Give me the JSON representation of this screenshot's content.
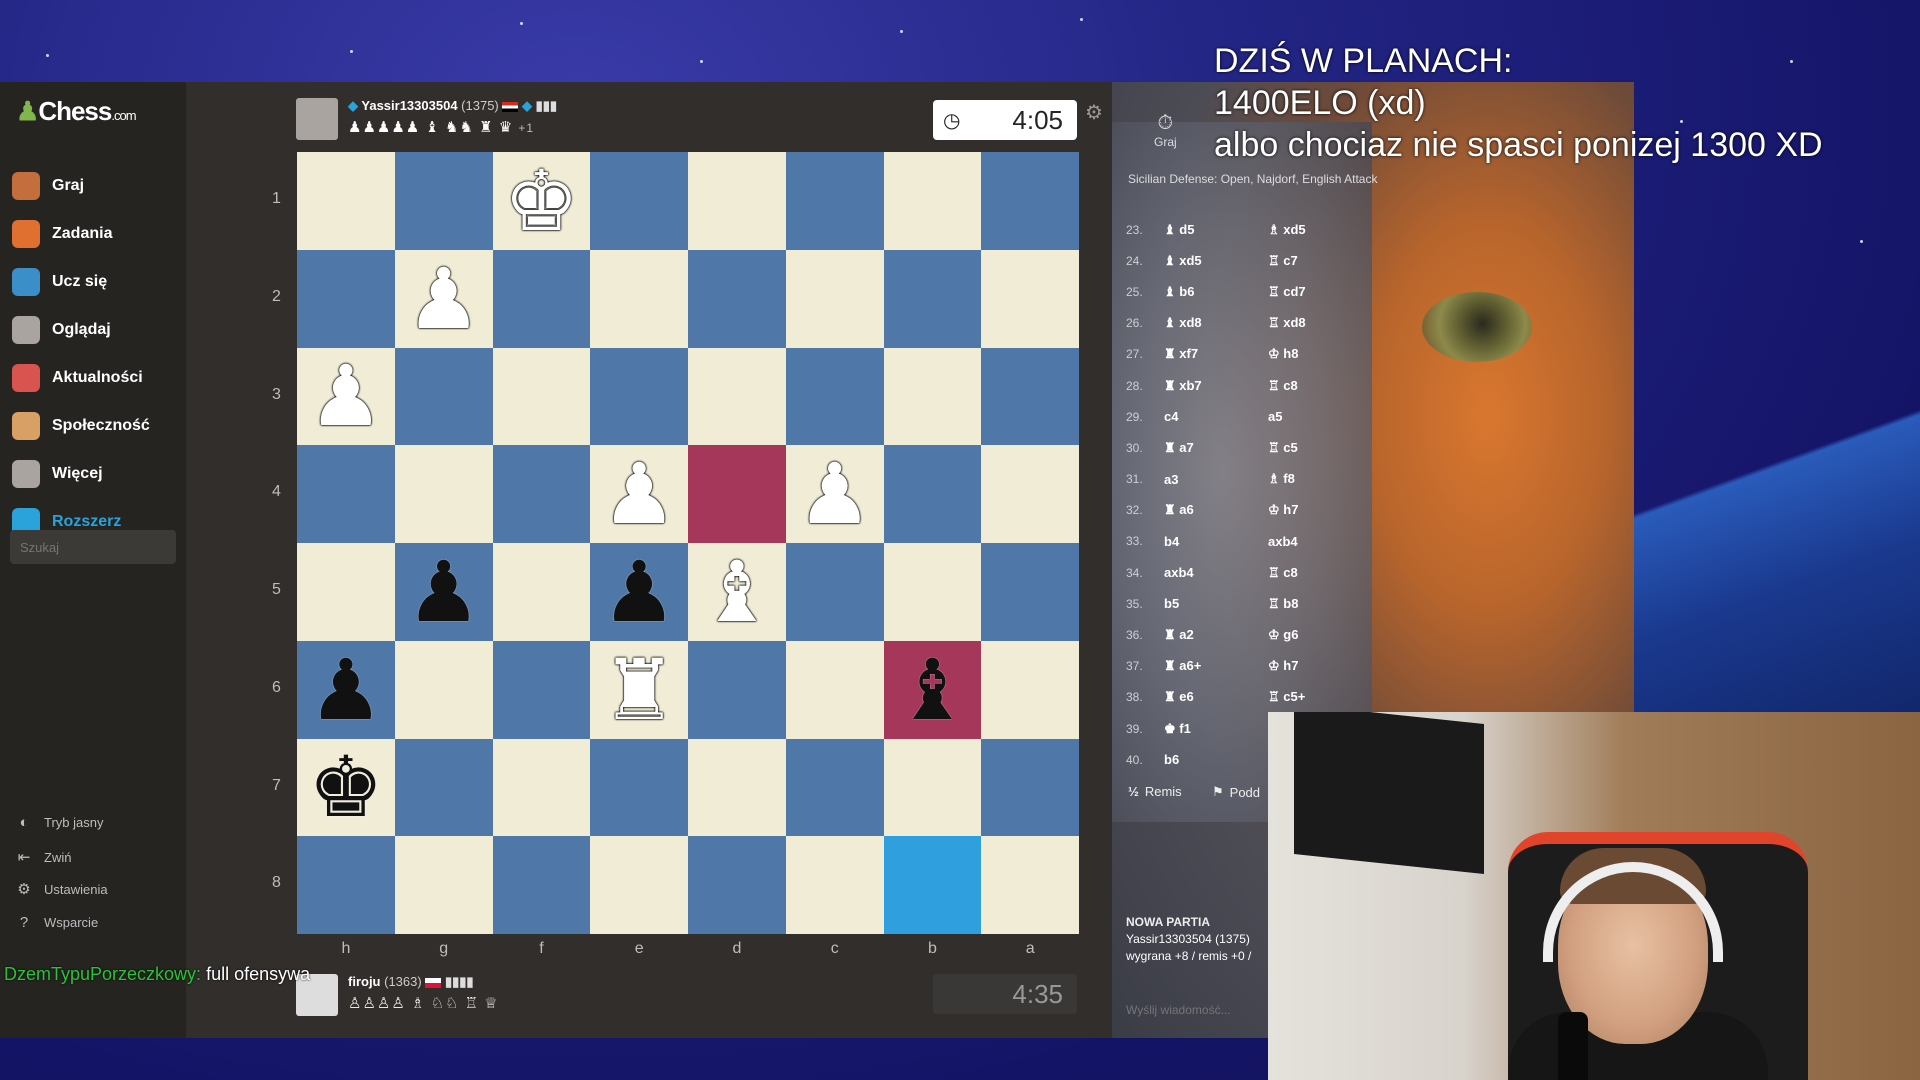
{
  "overlay": {
    "line1": "DZIŚ W PLANACH:",
    "line2": "1400ELO (xd)",
    "line3": "albo chociaz nie spasci ponizej 1300 XD"
  },
  "sidebar": {
    "logo_main": "Chess",
    "logo_suffix": ".com",
    "items": [
      {
        "label": "Graj",
        "icon": "play-icon",
        "color": "#c46d3d"
      },
      {
        "label": "Zadania",
        "icon": "puzzle-icon",
        "color": "#e0702f"
      },
      {
        "label": "Ucz się",
        "icon": "learn-icon",
        "color": "#3b8fc9"
      },
      {
        "label": "Oglądaj",
        "icon": "binoculars-icon",
        "color": "#a9a49f"
      },
      {
        "label": "Aktualności",
        "icon": "news-icon",
        "color": "#d9534f"
      },
      {
        "label": "Społeczność",
        "icon": "community-icon",
        "color": "#d9a066"
      },
      {
        "label": "Więcej",
        "icon": "more-icon",
        "color": "#a9a49f"
      },
      {
        "label": "Rozszerz",
        "icon": "diamond-icon",
        "color": "#29a3d9"
      }
    ],
    "search_placeholder": "Szukaj",
    "footer": [
      {
        "label": "Tryb jasny",
        "icon": "theme-icon"
      },
      {
        "label": "Zwiń",
        "icon": "collapse-icon"
      },
      {
        "label": "Ustawienia",
        "icon": "settings-icon"
      },
      {
        "label": "Wsparcie",
        "icon": "help-icon"
      }
    ]
  },
  "top_player": {
    "name": "Yassir13303504",
    "rating": "(1375)",
    "captured": "♟♟♟♟♟ ♝ ♞♞ ♜ ♛",
    "advantage": "+1",
    "clock": "4:05"
  },
  "bottom_player": {
    "name": "firoju",
    "rating": "(1363)",
    "captured": "♙♙♙♙ ♗ ♘♘ ♖ ♕",
    "clock": "4:35"
  },
  "board": {
    "ranks": [
      "1",
      "2",
      "3",
      "4",
      "5",
      "6",
      "7",
      "8"
    ],
    "files": [
      "h",
      "g",
      "f",
      "e",
      "d",
      "c",
      "b",
      "a"
    ],
    "highlight_from_color": "#a5375a",
    "highlight_to_color": "#2f9fdd",
    "squares": [
      [
        "",
        "",
        "wK",
        "",
        "",
        "",
        "",
        ""
      ],
      [
        "",
        "wP",
        "",
        "",
        "",
        "",
        "",
        ""
      ],
      [
        "wP",
        "",
        "",
        "",
        "",
        "",
        "",
        ""
      ],
      [
        "",
        "",
        "",
        "wP",
        "hl-red",
        "wP",
        "",
        ""
      ],
      [
        "",
        "bP",
        "",
        "bP",
        "wB",
        "",
        "",
        ""
      ],
      [
        "bP",
        "",
        "",
        "wR",
        "",
        "",
        "bB+hl-red",
        ""
      ],
      [
        "bK",
        "",
        "",
        "",
        "",
        "",
        "",
        ""
      ],
      [
        "",
        "",
        "",
        "",
        "",
        "",
        "hl-blue",
        ""
      ]
    ]
  },
  "panel": {
    "tab_label": "Graj",
    "opening": "Sicilian Defense: Open, Najdorf, English Attack",
    "moves": [
      {
        "n": "23.",
        "w": "♝ d5",
        "b": "♗ xd5"
      },
      {
        "n": "24.",
        "w": "♝ xd5",
        "b": "♖ c7"
      },
      {
        "n": "25.",
        "w": "♝ b6",
        "b": "♖ cd7"
      },
      {
        "n": "26.",
        "w": "♝ xd8",
        "b": "♖ xd8"
      },
      {
        "n": "27.",
        "w": "♜ xf7",
        "b": "♔ h8"
      },
      {
        "n": "28.",
        "w": "♜ xb7",
        "b": "♖ c8"
      },
      {
        "n": "29.",
        "w": "c4",
        "b": "a5"
      },
      {
        "n": "30.",
        "w": "♜ a7",
        "b": "♖ c5"
      },
      {
        "n": "31.",
        "w": "a3",
        "b": "♗ f8"
      },
      {
        "n": "32.",
        "w": "♜ a6",
        "b": "♔ h7"
      },
      {
        "n": "33.",
        "w": "b4",
        "b": "axb4"
      },
      {
        "n": "34.",
        "w": "axb4",
        "b": "♖ c8"
      },
      {
        "n": "35.",
        "w": "b5",
        "b": "♖ b8"
      },
      {
        "n": "36.",
        "w": "♜ a2",
        "b": "♔ g6"
      },
      {
        "n": "37.",
        "w": "♜ a6+",
        "b": "♔ h7"
      },
      {
        "n": "38.",
        "w": "♜ e6",
        "b": "♖ c5+"
      },
      {
        "n": "39.",
        "w": "♚ f1",
        "b": ""
      },
      {
        "n": "40.",
        "w": "b6",
        "b": ""
      }
    ],
    "draw_label": "Remis",
    "resign_label": "Podd",
    "draw_glyph": "½",
    "new_game_title": "NOWA PARTIA",
    "new_game_player": "Yassir13303504 (1375)",
    "new_game_result": "wygrana +8 / remis +0 /",
    "message_placeholder": "Wyślij wiadomość..."
  },
  "chat": {
    "user": "DzemTypuPorzeczkowy:",
    "text": " full ofensywa"
  }
}
